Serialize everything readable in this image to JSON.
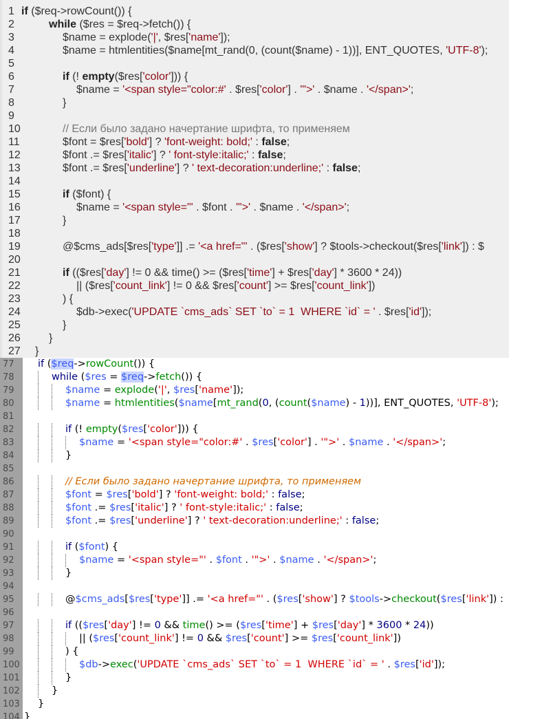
{
  "top": {
    "start": 1,
    "lines": [
      "if ($req->rowCount()) {",
      "        while ($res = $req->fetch()) {",
      "            $name = explode('|', $res['name']);",
      "            $name = htmlentities($name[mt_rand(0, (count($name) - 1))], ENT_QUOTES, 'UTF-8');",
      "",
      "            if (! empty($res['color'])) {",
      "                $name = '<span style=\"color:#' . $res['color'] . '\">' . $name . '</span>';",
      "            }",
      "",
      "            // Если было задано начертание шрифта, то применяем",
      "            $font = $res['bold'] ? 'font-weight: bold;' : false;",
      "            $font .= $res['italic'] ? ' font-style:italic;' : false;",
      "            $font .= $res['underline'] ? ' text-decoration:underline;' : false;",
      "",
      "            if ($font) {",
      "                $name = '<span style=\"' . $font . '\">' . $name . '</span>';",
      "            }",
      "",
      "            @$cms_ads[$res['type']] .= '<a href=\"' . ($res['show'] ? $tools->checkout($res['link']) : $",
      "",
      "            if (($res['day'] != 0 && time() >= ($res['time'] + $res['day'] * 3600 * 24))",
      "                || ($res['count_link'] != 0 && $res['count'] >= $res['count_link'])",
      "            ) {",
      "                $db->exec('UPDATE `cms_ads` SET `to` = 1  WHERE `id` = ' . $res['id']);",
      "            }",
      "        }",
      "    }"
    ]
  },
  "bottom": {
    "start": 77,
    "highlight_word": "$req",
    "lines": [
      "    if ($req->rowCount()) {",
      "        while ($res = $req->fetch()) {",
      "            $name = explode('|', $res['name']);",
      "            $name = htmlentities($name[mt_rand(0, (count($name) - 1))], ENT_QUOTES, 'UTF-8');",
      "",
      "            if (! empty($res['color'])) {",
      "                $name = '<span style=\"color:#' . $res['color'] . '\">' . $name . '</span>';",
      "            }",
      "",
      "            // Если было задано начертание шрифта, то применяем",
      "            $font = $res['bold'] ? 'font-weight: bold;' : false;",
      "            $font .= $res['italic'] ? ' font-style:italic;' : false;",
      "            $font .= $res['underline'] ? ' text-decoration:underline;' : false;",
      "",
      "            if ($font) {",
      "                $name = '<span style=\"' . $font . '\">' . $name . '</span>';",
      "            }",
      "",
      "            @$cms_ads[$res['type']] .= '<a href=\"' . ($res['show'] ? $tools->checkout($res['link']) :",
      "",
      "            if (($res['day'] != 0 && time() >= ($res['time'] + $res['day'] * 3600 * 24))",
      "                || ($res['count_link'] != 0 && $res['count'] >= $res['count_link'])",
      "            ) {",
      "                $db->exec('UPDATE `cms_ads` SET `to` = 1  WHERE `id` = ' . $res['id']);",
      "            }",
      "        }",
      "    }",
      "}"
    ]
  },
  "colors": {
    "variable": "#3b5cf0",
    "function": "#008a00",
    "string": "#d00000",
    "keyword": "#000080",
    "comment": "#d06a00"
  }
}
